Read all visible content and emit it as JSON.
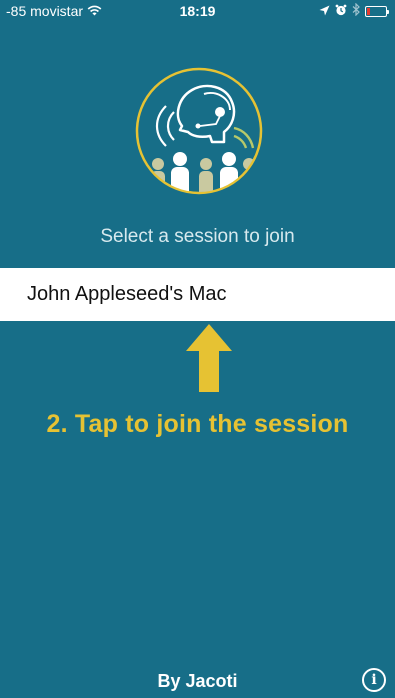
{
  "status_bar": {
    "carrier": "-85 movistar",
    "time": "18:19",
    "battery_level": 0.15,
    "icons": [
      "wifi-icon",
      "location-arrow-icon",
      "alarm-icon",
      "bluetooth-icon",
      "battery-icon"
    ]
  },
  "header": {
    "logo_icon": "headset-audience-logo",
    "prompt": "Select a session to join"
  },
  "sessions": [
    {
      "label": "John Appleseed's Mac"
    }
  ],
  "instruction": {
    "text": "2. Tap to join the session",
    "arrow_icon": "up-arrow-icon"
  },
  "footer": {
    "brand": "By Jacoti",
    "info_label": "i"
  },
  "colors": {
    "background": "#176e88",
    "accent": "#e6c233",
    "row_background": "#ffffff",
    "battery_low": "#e53b30"
  }
}
